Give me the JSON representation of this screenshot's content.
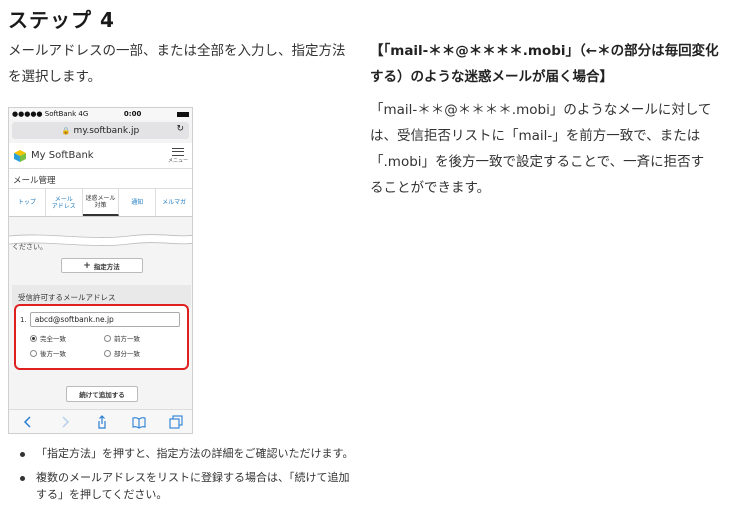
{
  "step_title": "ステップ 4",
  "left_intro": "メールアドレスの一部、または全部を入力し、指定方法を選択します。",
  "right_heading": "【「mail-＊＊@＊＊＊＊.mobi」（←＊の部分は毎回変化する）のような迷惑メールが届く場合】",
  "right_body": "「mail-＊＊@＊＊＊＊.mobi」のようなメールに対しては、受信拒否リストに「mail-」を前方一致で、または「.mobi」を後方一致で設定することで、一斉に拒否することができます。",
  "phone": {
    "status": {
      "carrier": "●●●●● SoftBank  4G",
      "time": "0:00"
    },
    "url": "my.softbank.jp",
    "app_name": "My SoftBank",
    "menu_label": "メニュー",
    "section_title": "メール管理",
    "tabs": [
      "トップ",
      "メール\nアドレス",
      "迷惑メール\n対策",
      "通知",
      "メルマガ"
    ],
    "clipped_text": "ください。",
    "method_button": "指定方法",
    "list_header": "受信許可するメールアドレス",
    "row_number": "1.",
    "email_value": "abcd@softbank.ne.jp",
    "radios": [
      "完全一致",
      "前方一致",
      "後方一致",
      "部分一致"
    ],
    "selected_radio": "完全一致",
    "add_button": "続けて追加する",
    "colors": {
      "highlight": "#e02020",
      "link": "#1f7bc2"
    },
    "toolbar_icons": [
      "back-icon",
      "forward-icon",
      "share-icon",
      "bookmarks-icon",
      "tabs-icon"
    ]
  },
  "bullets": [
    "「指定方法」を押すと、指定方法の詳細をご確認いただけます。",
    "複数のメールアドレスをリストに登録する場合は、「続けて追加する」を押してください。"
  ]
}
